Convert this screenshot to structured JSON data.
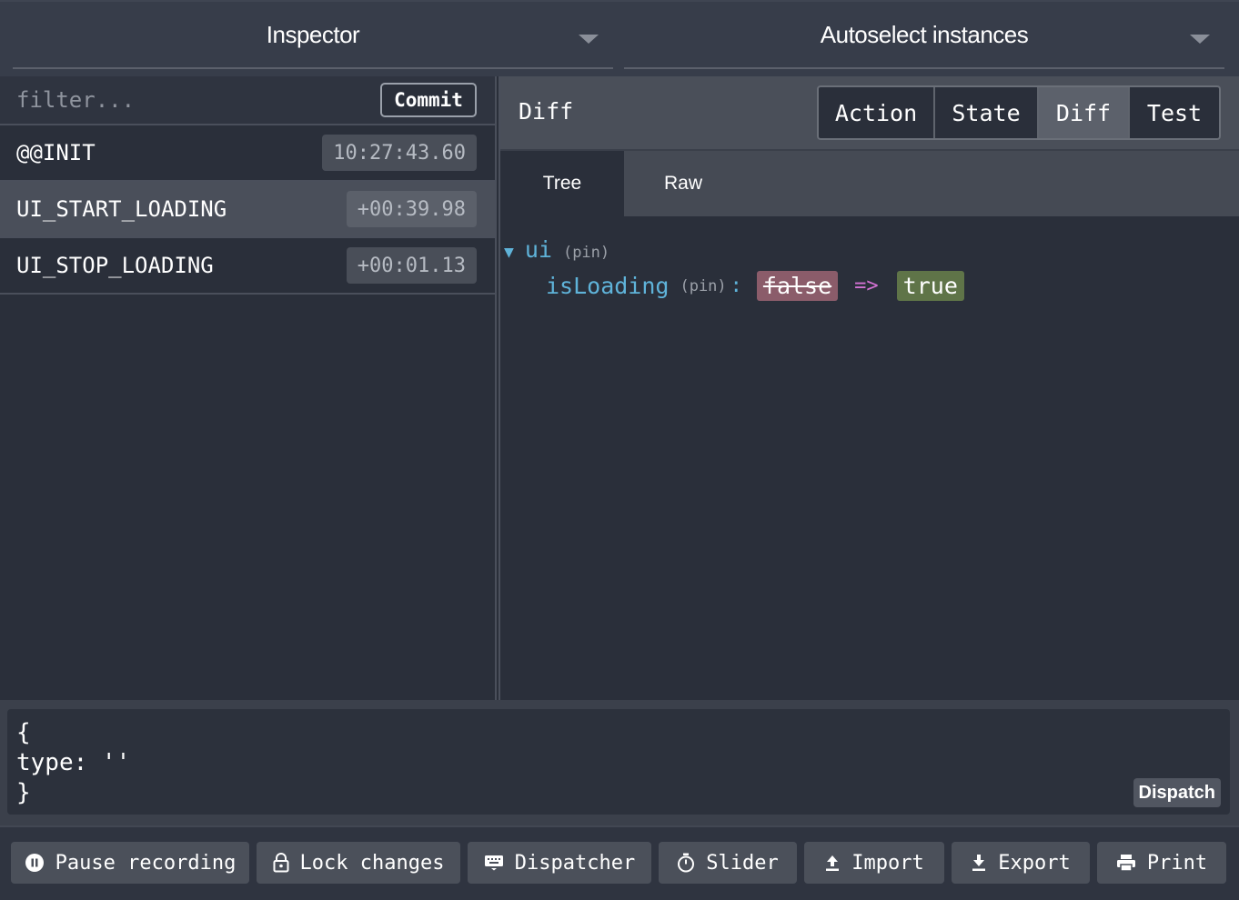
{
  "top_bar": {
    "monitor_select": "Inspector",
    "instance_select": "Autoselect instances"
  },
  "action_list": {
    "filter_placeholder": "filter...",
    "commit_label": "Commit",
    "items": [
      {
        "name": "@@INIT",
        "time": "10:27:43.60",
        "selected": false
      },
      {
        "name": "UI_START_LOADING",
        "time": "+00:39.98",
        "selected": true
      },
      {
        "name": "UI_STOP_LOADING",
        "time": "+00:01.13",
        "selected": false
      }
    ]
  },
  "preview": {
    "title": "Diff",
    "tabs": [
      "Action",
      "State",
      "Diff",
      "Test"
    ],
    "active_tab": "Diff",
    "subtabs": [
      "Tree",
      "Raw"
    ],
    "active_subtab": "Tree",
    "tree": {
      "root_key": "ui",
      "root_pin": "(pin)",
      "child_key": "isLoading",
      "child_pin": "(pin)",
      "colon": ":",
      "old_value": "false",
      "arrow": "=>",
      "new_value": "true"
    }
  },
  "dispatcher": {
    "code_line1": "{",
    "code_line2": "type: ''",
    "code_line3": "}",
    "dispatch_label": "Dispatch"
  },
  "toolbar": {
    "pause_label": "Pause recording",
    "lock_label": "Lock changes",
    "dispatcher_label": "Dispatcher",
    "slider_label": "Slider",
    "import_label": "Import",
    "export_label": "Export",
    "print_label": "Print"
  },
  "colors": {
    "background": "#2a2f3a",
    "key": "#5fb3d9",
    "removed": "#8b5c6a",
    "added": "#5f7448",
    "arrow": "#d472d4"
  }
}
